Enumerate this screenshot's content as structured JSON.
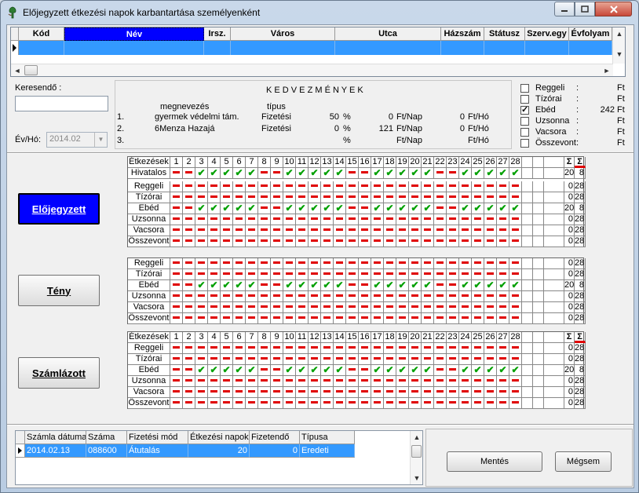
{
  "window": {
    "title": "Előjegyzett étkezési napok karbantartása személyenként"
  },
  "top_grid": {
    "columns": [
      {
        "label": "Kód",
        "w": 58
      },
      {
        "label": "Név",
        "w": 178,
        "selected": true
      },
      {
        "label": "Irsz.",
        "w": 34
      },
      {
        "label": "Város",
        "w": 133
      },
      {
        "label": "Utca",
        "w": 135
      },
      {
        "label": "Házszám",
        "w": 55
      },
      {
        "label": "Státusz",
        "w": 52
      },
      {
        "label": "Szerv.egy",
        "w": 56
      },
      {
        "label": "Évfolyam",
        "w": 55
      }
    ]
  },
  "search": {
    "label": "Keresendő :",
    "value": ""
  },
  "year_month": {
    "label": "Év/Hó:",
    "value": "2014.02"
  },
  "benefits": {
    "title": "K E D V E Z M É N Y E K",
    "col_name": "megnevezés",
    "col_type": "típus",
    "rows": [
      {
        "no": "1.",
        "name": "gyermek védelmi tám.",
        "type": "Fizetési",
        "pct": "50",
        "pct_sign": "%",
        "day": "0",
        "day_unit": "Ft/Nap",
        "month": "0",
        "month_unit": "Ft/Hó"
      },
      {
        "no": "2.",
        "name": "6Menza Hazajá",
        "type": "Fizetési",
        "pct": "0",
        "pct_sign": "%",
        "day": "121",
        "day_unit": "Ft/Nap",
        "month": "0",
        "month_unit": "Ft/Hó"
      },
      {
        "no": "3.",
        "name": "",
        "type": "",
        "pct": "",
        "pct_sign": "%",
        "day": "",
        "day_unit": "Ft/Nap",
        "month": "",
        "month_unit": "Ft/Hó"
      }
    ]
  },
  "meal_prices": [
    {
      "label": "Reggeli",
      "sep": ":",
      "value": "",
      "unit": "Ft",
      "checked": false
    },
    {
      "label": "Tízórai",
      "sep": ":",
      "value": "",
      "unit": "Ft",
      "checked": false
    },
    {
      "label": "Ebéd",
      "sep": ":",
      "value": "242",
      "unit": "Ft",
      "checked": true
    },
    {
      "label": "Uzsonna",
      "sep": ":",
      "value": "",
      "unit": "Ft",
      "checked": false
    },
    {
      "label": "Vacsora",
      "sep": ":",
      "value": "",
      "unit": "Ft",
      "checked": false
    },
    {
      "label": "Összevont",
      "sep": ":",
      "value": "",
      "unit": "Ft",
      "checked": false
    }
  ],
  "sections": {
    "elojegyzett": {
      "label": "Előjegyzett",
      "active": true
    },
    "teny": {
      "label": "Tény",
      "active": false
    },
    "szamlazott": {
      "label": "Számlázott",
      "active": false
    }
  },
  "calendar": {
    "header_label": "Étkezések",
    "hivatalos_label": "Hivatalos",
    "days": [
      "1",
      "2",
      "3",
      "4",
      "5",
      "6",
      "7",
      "8",
      "9",
      "10",
      "11",
      "12",
      "13",
      "14",
      "15",
      "16",
      "17",
      "18",
      "19",
      "20",
      "21",
      "22",
      "23",
      "24",
      "25",
      "26",
      "27",
      "28"
    ],
    "workday_pattern": [
      0,
      0,
      1,
      1,
      1,
      1,
      1,
      0,
      0,
      1,
      1,
      1,
      1,
      1,
      0,
      0,
      1,
      1,
      1,
      1,
      1,
      0,
      0,
      1,
      1,
      1,
      1,
      1
    ],
    "hivatalos_sum": "20",
    "hivatalos_minus": "8",
    "sum_symbol": "Σ",
    "meals": [
      {
        "label": "Reggeli",
        "sum": "0",
        "minus": "28",
        "pattern": "none"
      },
      {
        "label": "Tízórai",
        "sum": "0",
        "minus": "28",
        "pattern": "none"
      },
      {
        "label": "Ebéd",
        "sum": "20",
        "minus": "8",
        "pattern": "work"
      },
      {
        "label": "Uzsonna",
        "sum": "0",
        "minus": "28",
        "pattern": "none"
      },
      {
        "label": "Vacsora",
        "sum": "0",
        "minus": "28",
        "pattern": "none"
      },
      {
        "label": "Összevont",
        "sum": "0",
        "minus": "28",
        "pattern": "none"
      }
    ]
  },
  "invoice_table": {
    "columns": [
      {
        "label": "Számla dátuma",
        "w": 78
      },
      {
        "label": "Száma",
        "w": 52
      },
      {
        "label": "Fizetési mód",
        "w": 78
      },
      {
        "label": "Étkezési napok",
        "w": 78
      },
      {
        "label": "Fizetendő",
        "w": 64
      },
      {
        "label": "Típusa",
        "w": 70
      }
    ],
    "rows": [
      [
        "2014.02.13",
        "088600",
        "Átutalás",
        "20",
        "0",
        "Eredeti"
      ]
    ]
  },
  "buttons": {
    "save": "Mentés",
    "cancel": "Mégsem"
  }
}
